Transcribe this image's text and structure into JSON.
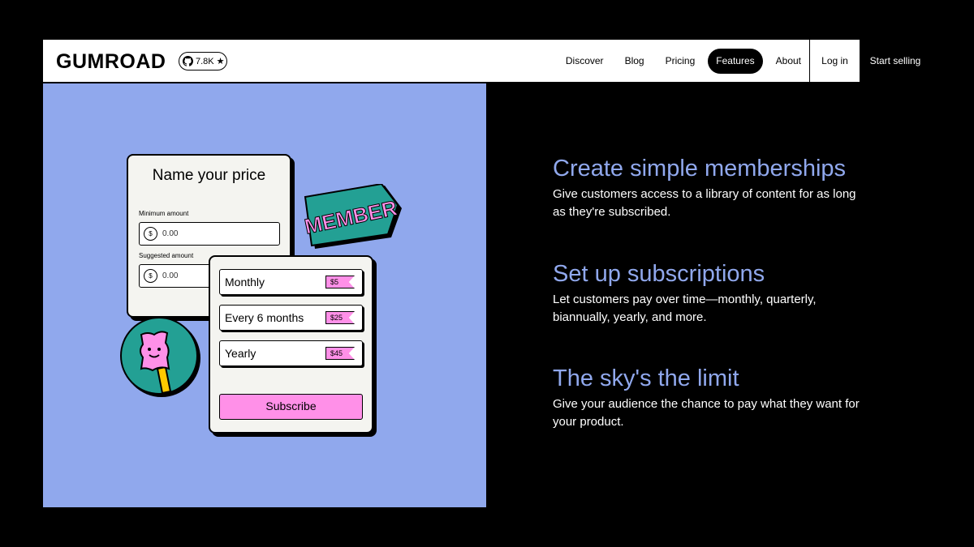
{
  "header": {
    "logo": "GUMROAD",
    "github_stars": "7.8K",
    "nav": [
      "Discover",
      "Blog",
      "Pricing",
      "Features",
      "About"
    ],
    "active_nav": "Features",
    "login": "Log in",
    "start_selling": "Start selling"
  },
  "illustration": {
    "price_card": {
      "title": "Name your price",
      "minimum_label": "Minimum amount",
      "minimum_value": "0.00",
      "suggested_label": "Suggested amount",
      "suggested_value": "0.00",
      "currency_symbol": "$"
    },
    "member_tag": "MEMBER",
    "plans": [
      {
        "name": "Monthly",
        "price": "$5"
      },
      {
        "name": "Every 6 months",
        "price": "$25"
      },
      {
        "name": "Yearly",
        "price": "$45"
      }
    ],
    "subscribe_label": "Subscribe"
  },
  "features": [
    {
      "title": "Create simple memberships",
      "body": "Give customers access to a library of content for as long as they're subscribed."
    },
    {
      "title": "Set up subscriptions",
      "body": "Let customers pay over time—monthly, quarterly, biannually, yearly, and more."
    },
    {
      "title": "The sky's the limit",
      "body": "Give your audience the chance to pay what they want for your product."
    }
  ],
  "colors": {
    "accent_blue": "#90a8ed",
    "pink": "#ff90e8",
    "teal": "#23a094",
    "yellow": "#ffc900"
  }
}
